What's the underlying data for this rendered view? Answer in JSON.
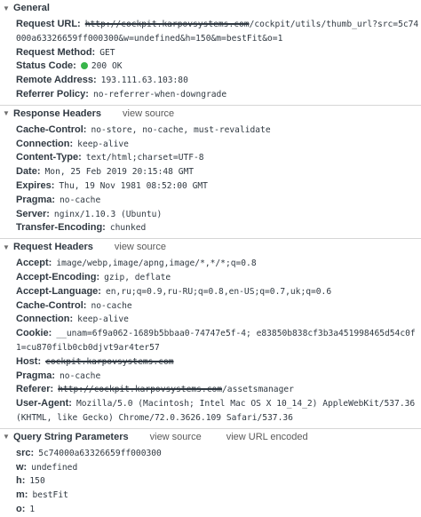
{
  "general": {
    "title": "General",
    "request_url": {
      "key": "Request URL:",
      "strike": "http://cockpit.karpovsystems.com",
      "rest": "/cockpit/utils/thumb_url?src=5c74000a63326659ff000300&w=undefined&h=150&m=bestFit&o=1"
    },
    "request_method": {
      "key": "Request Method:",
      "value": "GET"
    },
    "status_code": {
      "key": "Status Code:",
      "value": "200 OK",
      "color": "#39b54a"
    },
    "remote_address": {
      "key": "Remote Address:",
      "value": "193.111.63.103:80"
    },
    "referrer_policy": {
      "key": "Referrer Policy:",
      "value": "no-referrer-when-downgrade"
    }
  },
  "response_headers": {
    "title": "Response Headers",
    "view_source": "view source",
    "rows": [
      {
        "key": "Cache-Control:",
        "value": "no-store, no-cache, must-revalidate"
      },
      {
        "key": "Connection:",
        "value": "keep-alive"
      },
      {
        "key": "Content-Type:",
        "value": "text/html;charset=UTF-8"
      },
      {
        "key": "Date:",
        "value": "Mon, 25 Feb 2019 20:15:48 GMT"
      },
      {
        "key": "Expires:",
        "value": "Thu, 19 Nov 1981 08:52:00 GMT"
      },
      {
        "key": "Pragma:",
        "value": "no-cache"
      },
      {
        "key": "Server:",
        "value": "nginx/1.10.3 (Ubuntu)"
      },
      {
        "key": "Transfer-Encoding:",
        "value": "chunked"
      }
    ]
  },
  "request_headers": {
    "title": "Request Headers",
    "view_source": "view source",
    "accept": {
      "key": "Accept:",
      "value": "image/webp,image/apng,image/*,*/*;q=0.8"
    },
    "accept_encoding": {
      "key": "Accept-Encoding:",
      "value": "gzip, deflate"
    },
    "accept_language": {
      "key": "Accept-Language:",
      "value": "en,ru;q=0.9,ru-RU;q=0.8,en-US;q=0.7,uk;q=0.6"
    },
    "cache_control": {
      "key": "Cache-Control:",
      "value": "no-cache"
    },
    "connection": {
      "key": "Connection:",
      "value": "keep-alive"
    },
    "cookie": {
      "key": "Cookie:",
      "value": "__unam=6f9a062-1689b5bbaa0-74747e5f-4; e83850b838cf3b3a451998465d54c0f1=cu870filb0cb0djvt9ar4ter57"
    },
    "host": {
      "key": "Host:",
      "strike": "cockpit.karpovsystems.com"
    },
    "pragma": {
      "key": "Pragma:",
      "value": "no-cache"
    },
    "referer": {
      "key": "Referer:",
      "strike": "http://cockpit.karpovsystems.com",
      "rest": "/assetsmanager"
    },
    "user_agent": {
      "key": "User-Agent:",
      "value": "Mozilla/5.0 (Macintosh; Intel Mac OS X 10_14_2) AppleWebKit/537.36 (KHTML, like Gecko) Chrome/72.0.3626.109 Safari/537.36"
    }
  },
  "query_string": {
    "title": "Query String Parameters",
    "view_source": "view source",
    "view_url_encoded": "view URL encoded",
    "rows": [
      {
        "key": "src:",
        "value": "5c74000a63326659ff000300"
      },
      {
        "key": "w:",
        "value": "undefined"
      },
      {
        "key": "h:",
        "value": "150"
      },
      {
        "key": "m:",
        "value": "bestFit"
      },
      {
        "key": "o:",
        "value": "1"
      }
    ]
  }
}
